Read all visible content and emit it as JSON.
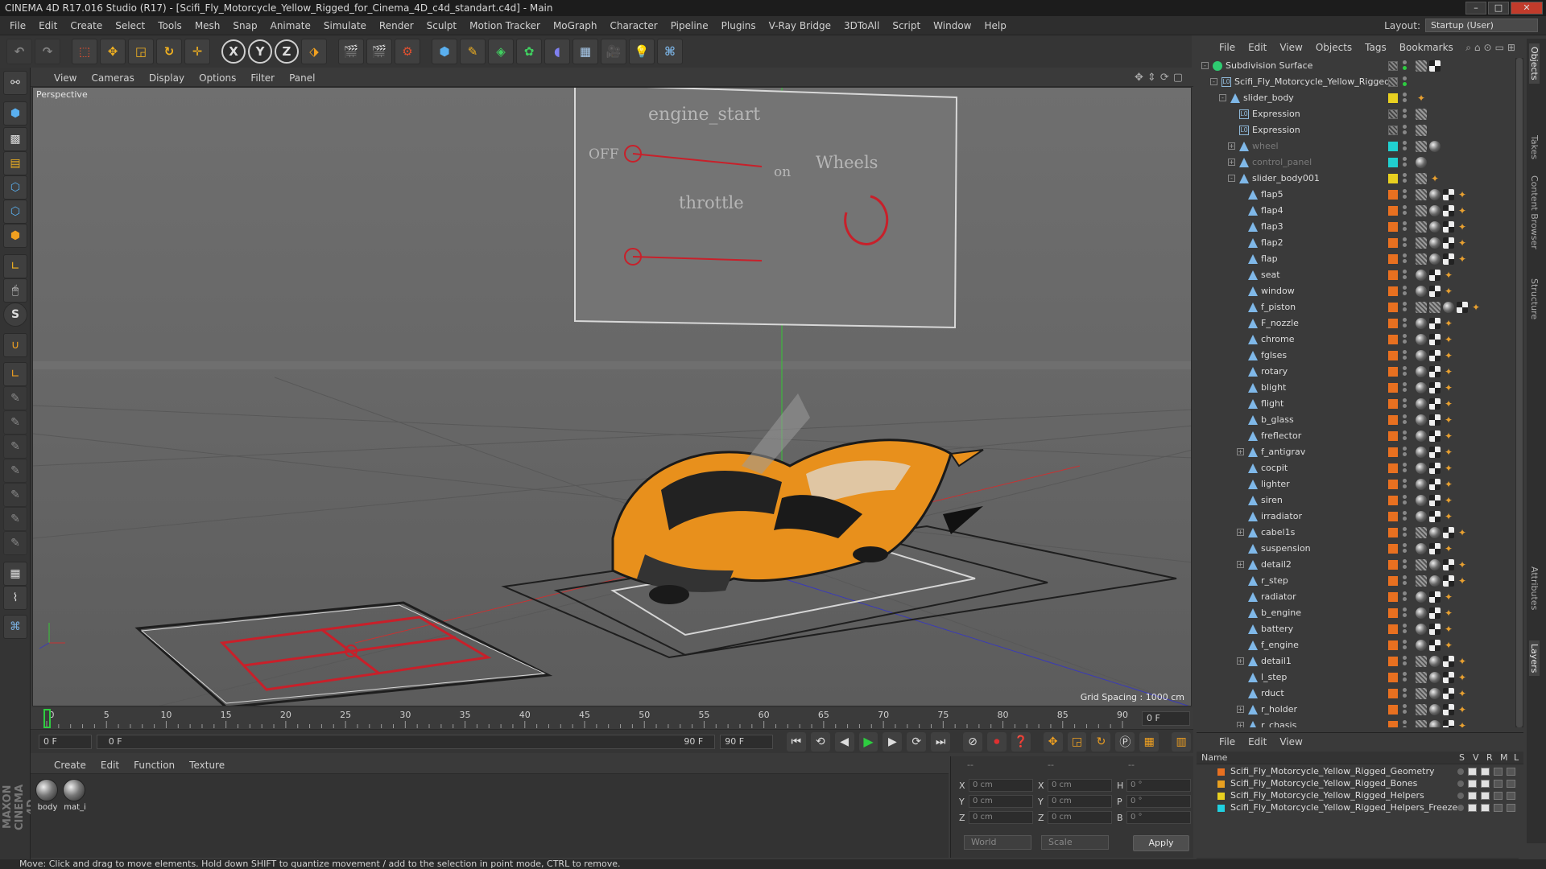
{
  "window": {
    "title": "CINEMA 4D R17.016 Studio (R17) - [Scifi_Fly_Motorcycle_Yellow_Rigged_for_Cinema_4D_c4d_standart.c4d] - Main"
  },
  "menubar": {
    "items": [
      "File",
      "Edit",
      "Create",
      "Select",
      "Tools",
      "Mesh",
      "Snap",
      "Animate",
      "Simulate",
      "Render",
      "Sculpt",
      "Motion Tracker",
      "MoGraph",
      "Character",
      "Pipeline",
      "Plugins",
      "V-Ray Bridge",
      "3DToAll",
      "Script",
      "Window",
      "Help"
    ],
    "layout_label": "Layout:",
    "layout_value": "Startup (User)"
  },
  "toolbar": {
    "axis_x": "X",
    "axis_y": "Y",
    "axis_z": "Z"
  },
  "lefttoolbar": {
    "sculpt_s": "S"
  },
  "viewport": {
    "menu": [
      "View",
      "Cameras",
      "Display",
      "Options",
      "Filter",
      "Panel"
    ],
    "label": "Perspective",
    "grid_spacing": "Grid Spacing : 1000 cm",
    "hud": {
      "engine_start": "engine_start",
      "off": "OFF",
      "on": "on",
      "throttle": "throttle",
      "wheels": "Wheels"
    },
    "colors": {
      "bike": "#e8901c",
      "controls": "#c8202a",
      "x_axis": "#c83232",
      "y_axis": "#36c836",
      "z_axis": "#3a3ab8"
    }
  },
  "timeline": {
    "ticks": [
      "0",
      "5",
      "10",
      "15",
      "20",
      "25",
      "30",
      "35",
      "40",
      "45",
      "50",
      "55",
      "60",
      "65",
      "70",
      "75",
      "80",
      "85",
      "90"
    ],
    "current_frame": "0 F"
  },
  "transport": {
    "start_field": "0 F",
    "range_start": "0 F",
    "range_end": "90 F",
    "end_field": "90 F"
  },
  "materials": {
    "menu": [
      "Create",
      "Edit",
      "Function",
      "Texture"
    ],
    "items": [
      {
        "label": "body"
      },
      {
        "label": "mat_i"
      }
    ]
  },
  "coordinates": {
    "header_dashes": [
      "--",
      "--",
      "--"
    ],
    "rows": [
      {
        "a1": "X",
        "v1": "0 cm",
        "a2": "X",
        "v2": "0 cm",
        "a3": "H",
        "v3": "0 °"
      },
      {
        "a1": "Y",
        "v1": "0 cm",
        "a2": "Y",
        "v2": "0 cm",
        "a3": "P",
        "v3": "0 °"
      },
      {
        "a1": "Z",
        "v1": "0 cm",
        "a2": "Z",
        "v2": "0 cm",
        "a3": "B",
        "v3": "0 °"
      }
    ],
    "world": "World",
    "scale": "Scale",
    "apply": "Apply"
  },
  "object_manager": {
    "menu": [
      "File",
      "Edit",
      "View",
      "Objects",
      "Tags",
      "Bookmarks"
    ],
    "objects": [
      {
        "name": "Subdivision Surface",
        "depth": 0,
        "icon": "sub",
        "expand": "-",
        "layer": "",
        "tags": [
          "exp",
          "chk"
        ]
      },
      {
        "name": "Scifi_Fly_Motorcycle_Yellow_Rigged",
        "depth": 1,
        "icon": "null",
        "expand": "-",
        "layer": "",
        "tags": []
      },
      {
        "name": "slider_body",
        "depth": 2,
        "icon": "bone",
        "expand": "-",
        "layer": "#e8d020",
        "tags": [
          "ik"
        ]
      },
      {
        "name": "Expression",
        "depth": 3,
        "icon": "null",
        "expand": "",
        "layer": "",
        "tags": [
          "exp"
        ]
      },
      {
        "name": "Expression",
        "depth": 3,
        "icon": "null",
        "expand": "",
        "layer": "",
        "tags": [
          "exp"
        ]
      },
      {
        "name": "wheel",
        "depth": 3,
        "icon": "bone",
        "expand": "+",
        "layer": "#20d0d0",
        "dim": true,
        "tags": [
          "exp",
          "mat"
        ]
      },
      {
        "name": "control_panel",
        "depth": 3,
        "icon": "bone",
        "expand": "+",
        "layer": "#20d0d0",
        "dim": true,
        "tags": [
          "mat"
        ]
      },
      {
        "name": "slider_body001",
        "depth": 3,
        "icon": "bone",
        "expand": "-",
        "layer": "#e8d020",
        "tags": [
          "exp",
          "ik"
        ]
      },
      {
        "name": "flap5",
        "depth": 4,
        "icon": "bone",
        "expand": "",
        "layer": "#e87020",
        "tags": [
          "exp",
          "mat",
          "chk",
          "ik"
        ]
      },
      {
        "name": "flap4",
        "depth": 4,
        "icon": "bone",
        "expand": "",
        "layer": "#e87020",
        "tags": [
          "exp",
          "mat",
          "chk",
          "ik"
        ]
      },
      {
        "name": "flap3",
        "depth": 4,
        "icon": "bone",
        "expand": "",
        "layer": "#e87020",
        "tags": [
          "exp",
          "mat",
          "chk",
          "ik"
        ]
      },
      {
        "name": "flap2",
        "depth": 4,
        "icon": "bone",
        "expand": "",
        "layer": "#e87020",
        "tags": [
          "exp",
          "mat",
          "chk",
          "ik"
        ]
      },
      {
        "name": "flap",
        "depth": 4,
        "icon": "bone",
        "expand": "",
        "layer": "#e87020",
        "tags": [
          "exp",
          "mat",
          "chk",
          "ik"
        ]
      },
      {
        "name": "seat",
        "depth": 4,
        "icon": "bone",
        "expand": "",
        "layer": "#e87020",
        "tags": [
          "mat",
          "chk",
          "ik"
        ]
      },
      {
        "name": "window",
        "depth": 4,
        "icon": "bone",
        "expand": "",
        "layer": "#e87020",
        "tags": [
          "mat",
          "chk",
          "ik"
        ]
      },
      {
        "name": "f_piston",
        "depth": 4,
        "icon": "bone",
        "expand": "",
        "layer": "#e87020",
        "tags": [
          "exp",
          "exp",
          "mat",
          "chk",
          "ik"
        ]
      },
      {
        "name": "F_nozzle",
        "depth": 4,
        "icon": "bone",
        "expand": "",
        "layer": "#e87020",
        "tags": [
          "mat",
          "chk",
          "ik"
        ]
      },
      {
        "name": "chrome",
        "depth": 4,
        "icon": "bone",
        "expand": "",
        "layer": "#e87020",
        "tags": [
          "mat",
          "chk",
          "ik"
        ]
      },
      {
        "name": "fglses",
        "depth": 4,
        "icon": "bone",
        "expand": "",
        "layer": "#e87020",
        "tags": [
          "mat",
          "chk",
          "ik"
        ]
      },
      {
        "name": "rotary",
        "depth": 4,
        "icon": "bone",
        "expand": "",
        "layer": "#e87020",
        "tags": [
          "mat",
          "chk",
          "ik"
        ]
      },
      {
        "name": "blight",
        "depth": 4,
        "icon": "bone",
        "expand": "",
        "layer": "#e87020",
        "tags": [
          "mat",
          "chk",
          "ik"
        ]
      },
      {
        "name": "flight",
        "depth": 4,
        "icon": "bone",
        "expand": "",
        "layer": "#e87020",
        "tags": [
          "mat",
          "chk",
          "ik"
        ]
      },
      {
        "name": "b_glass",
        "depth": 4,
        "icon": "bone",
        "expand": "",
        "layer": "#e87020",
        "tags": [
          "mat",
          "chk",
          "ik"
        ]
      },
      {
        "name": "freflector",
        "depth": 4,
        "icon": "bone",
        "expand": "",
        "layer": "#e87020",
        "tags": [
          "mat",
          "chk",
          "ik"
        ]
      },
      {
        "name": "f_antigrav",
        "depth": 4,
        "icon": "bone",
        "expand": "+",
        "layer": "#e87020",
        "tags": [
          "mat",
          "chk",
          "ik"
        ]
      },
      {
        "name": "cocpit",
        "depth": 4,
        "icon": "bone",
        "expand": "",
        "layer": "#e87020",
        "tags": [
          "mat",
          "chk",
          "ik"
        ]
      },
      {
        "name": "lighter",
        "depth": 4,
        "icon": "bone",
        "expand": "",
        "layer": "#e87020",
        "tags": [
          "mat",
          "chk",
          "ik"
        ]
      },
      {
        "name": "siren",
        "depth": 4,
        "icon": "bone",
        "expand": "",
        "layer": "#e87020",
        "tags": [
          "mat",
          "chk",
          "ik"
        ]
      },
      {
        "name": "irradiator",
        "depth": 4,
        "icon": "bone",
        "expand": "",
        "layer": "#e87020",
        "tags": [
          "mat",
          "chk",
          "ik"
        ]
      },
      {
        "name": "cabel1s",
        "depth": 4,
        "icon": "bone",
        "expand": "+",
        "layer": "#e87020",
        "tags": [
          "exp",
          "mat",
          "chk",
          "ik"
        ]
      },
      {
        "name": "suspension",
        "depth": 4,
        "icon": "bone",
        "expand": "",
        "layer": "#e87020",
        "tags": [
          "mat",
          "chk",
          "ik"
        ]
      },
      {
        "name": "detail2",
        "depth": 4,
        "icon": "bone",
        "expand": "+",
        "layer": "#e87020",
        "tags": [
          "exp",
          "mat",
          "chk",
          "ik"
        ]
      },
      {
        "name": "r_step",
        "depth": 4,
        "icon": "bone",
        "expand": "",
        "layer": "#e87020",
        "tags": [
          "exp",
          "mat",
          "chk",
          "ik"
        ]
      },
      {
        "name": "radiator",
        "depth": 4,
        "icon": "bone",
        "expand": "",
        "layer": "#e87020",
        "tags": [
          "mat",
          "chk",
          "ik"
        ]
      },
      {
        "name": "b_engine",
        "depth": 4,
        "icon": "bone",
        "expand": "",
        "layer": "#e87020",
        "tags": [
          "mat",
          "chk",
          "ik"
        ]
      },
      {
        "name": "battery",
        "depth": 4,
        "icon": "bone",
        "expand": "",
        "layer": "#e87020",
        "tags": [
          "mat",
          "chk",
          "ik"
        ]
      },
      {
        "name": "f_engine",
        "depth": 4,
        "icon": "bone",
        "expand": "",
        "layer": "#e87020",
        "tags": [
          "mat",
          "chk",
          "ik"
        ]
      },
      {
        "name": "detail1",
        "depth": 4,
        "icon": "bone",
        "expand": "+",
        "layer": "#e87020",
        "tags": [
          "exp",
          "mat",
          "chk",
          "ik"
        ]
      },
      {
        "name": "l_step",
        "depth": 4,
        "icon": "bone",
        "expand": "",
        "layer": "#e87020",
        "tags": [
          "exp",
          "mat",
          "chk",
          "ik"
        ]
      },
      {
        "name": "rduct",
        "depth": 4,
        "icon": "bone",
        "expand": "",
        "layer": "#e87020",
        "tags": [
          "exp",
          "mat",
          "chk",
          "ik"
        ]
      },
      {
        "name": "r_holder",
        "depth": 4,
        "icon": "bone",
        "expand": "+",
        "layer": "#e87020",
        "tags": [
          "exp",
          "mat",
          "chk",
          "ik"
        ]
      },
      {
        "name": "r_chasis",
        "depth": 4,
        "icon": "bone",
        "expand": "+",
        "layer": "#e87020",
        "tags": [
          "exp",
          "mat",
          "chk",
          "ik"
        ]
      }
    ]
  },
  "right_tabs": [
    "Objects",
    "Takes",
    "Content Browser",
    "Structure",
    "Attributes",
    "Layers"
  ],
  "layers_panel": {
    "menu": [
      "File",
      "Edit",
      "View"
    ],
    "header": {
      "name": "Name",
      "s": "S",
      "v": "V",
      "r": "R",
      "m": "M",
      "l": "L"
    },
    "layers": [
      {
        "name": "Scifi_Fly_Motorcycle_Yellow_Rigged_Geometry",
        "color": "#e87020"
      },
      {
        "name": "Scifi_Fly_Motorcycle_Yellow_Rigged_Bones",
        "color": "#e8a020"
      },
      {
        "name": "Scifi_Fly_Motorcycle_Yellow_Rigged_Helpers",
        "color": "#e8d020"
      },
      {
        "name": "Scifi_Fly_Motorcycle_Yellow_Rigged_Helpers_Freeze",
        "color": "#20d0e0"
      }
    ]
  },
  "status": {
    "text": "Move: Click and drag to move elements. Hold down SHIFT to quantize movement / add to the selection in point mode, CTRL to remove."
  }
}
